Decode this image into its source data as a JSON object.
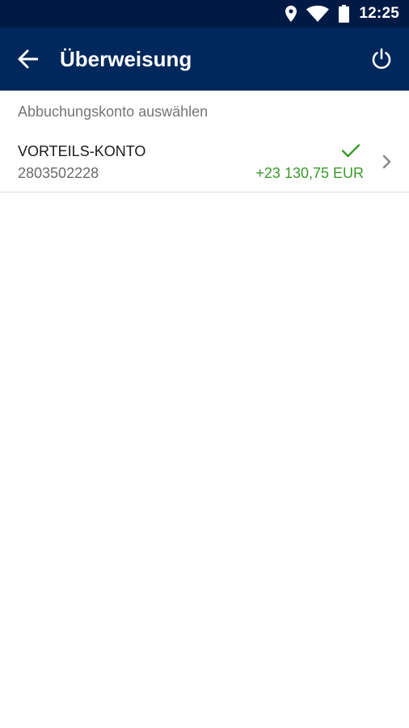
{
  "status_bar": {
    "time": "12:25",
    "icons": [
      "location-icon",
      "wifi-icon",
      "battery-icon"
    ],
    "background": "#001a46"
  },
  "app_bar": {
    "title": "Überweisung",
    "back_icon": "arrow-back-icon",
    "power_icon": "power-icon",
    "background": "#00285c"
  },
  "section": {
    "label": "Abbuchungskonto auswählen"
  },
  "accounts": [
    {
      "name": "VORTEILS-KONTO",
      "number": "2803502228",
      "balance": "+23 130,75 EUR",
      "selected": true,
      "balance_color": "#3a9a2a"
    }
  ]
}
